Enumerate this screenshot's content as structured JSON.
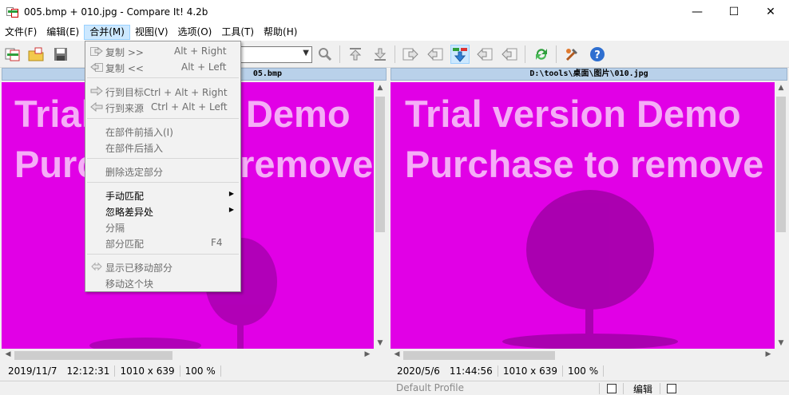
{
  "window": {
    "title": "005.bmp + 010.jpg - Compare It! 4.2b",
    "minimize": "—",
    "maximize": "☐",
    "close": "✕"
  },
  "menubar": [
    {
      "label": "文件(F)"
    },
    {
      "label": "编辑(E)"
    },
    {
      "label": "合并(M)",
      "active": true
    },
    {
      "label": "视图(V)"
    },
    {
      "label": "选项(O)"
    },
    {
      "label": "工具(T)"
    },
    {
      "label": "帮助(H)"
    }
  ],
  "toolbar": {
    "icons": [
      "open-compare-icon",
      "open-folder-icon",
      "save-icon",
      "search-icon",
      "first-diff-icon",
      "last-diff-icon",
      "copy-right-icon",
      "copy-left-icon",
      "next-diff-icon",
      "prev-left-icon",
      "prev-right-icon",
      "refresh-icon",
      "tools-icon",
      "help-icon"
    ],
    "combo_value": ""
  },
  "left_pane": {
    "path": "D:\\tools\\桌面\\图片\\005.bmp",
    "path_visible": "05.bmp",
    "watermark_line1": "Trial version Demo",
    "watermark_line2": "Purchase to remove",
    "date": "2019/11/7",
    "time": "12:12:31",
    "dimensions": "1010 x 639",
    "zoom": "100 %"
  },
  "right_pane": {
    "path": "D:\\tools\\桌面\\图片\\010.jpg",
    "watermark_line1": "Trial version Demo",
    "watermark_line2": "Purchase to remove",
    "date": "2020/5/6",
    "time": "11:44:56",
    "dimensions": "1010 x 639",
    "zoom": "100 %"
  },
  "statusbar": {
    "profile": "Default Profile",
    "edit_label": "编辑"
  },
  "merge_menu": {
    "items": [
      {
        "label": "复制  >>",
        "shortcut": "Alt + Right",
        "icon": "copy-right-icon",
        "enabled": false
      },
      {
        "label": "复制  <<",
        "shortcut": "Alt + Left",
        "icon": "copy-left-icon",
        "enabled": false
      },
      {
        "label": "行到目标Ctrl + Alt + Right",
        "shortcut": "",
        "icon": "line-to-target-icon",
        "enabled": false
      },
      {
        "label": "行到来源",
        "shortcut": "Ctrl + Alt + Left",
        "icon": "line-to-source-icon",
        "enabled": false
      },
      {
        "label": "在部件前插入(I)",
        "shortcut": "",
        "enabled": false
      },
      {
        "label": "在部件后插入",
        "shortcut": "",
        "enabled": false
      },
      {
        "label": "删除选定部分",
        "shortcut": "",
        "enabled": false
      },
      {
        "label": "手动匹配",
        "shortcut": "",
        "enabled": true,
        "submenu": true
      },
      {
        "label": "忽略差异处",
        "shortcut": "",
        "enabled": true,
        "submenu": true
      },
      {
        "label": "分隔",
        "shortcut": "",
        "enabled": false
      },
      {
        "label": "部分匹配",
        "shortcut": "F4",
        "enabled": false
      },
      {
        "label": "显示已移动部分",
        "shortcut": "",
        "icon": "show-moved-icon",
        "enabled": false
      },
      {
        "label": "移动这个块",
        "shortcut": "",
        "enabled": false
      }
    ]
  },
  "colors": {
    "image_magenta": "#e100e6",
    "pane_header": "#b9d1ea",
    "menu_highlight": "#cce8ff"
  }
}
